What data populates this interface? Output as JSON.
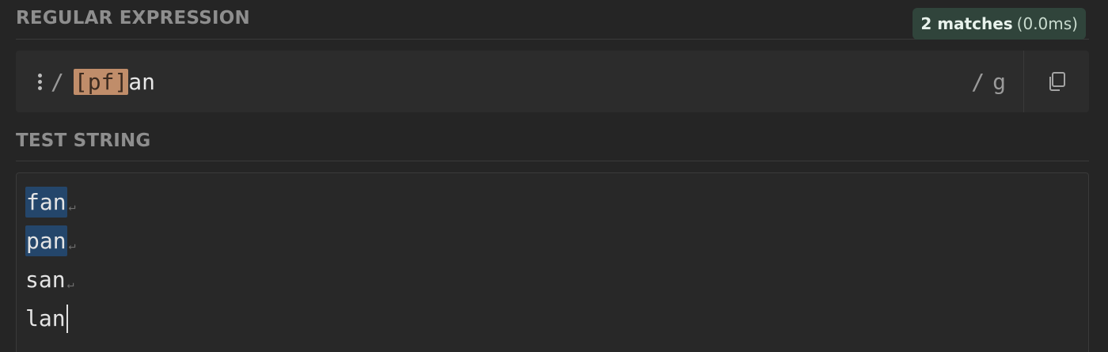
{
  "regex_section": {
    "title": "REGULAR EXPRESSION",
    "match_count": "2 matches",
    "match_time": "(0.0ms)",
    "open_delimiter": "/",
    "pattern_class": "[pf]",
    "pattern_rest": "an",
    "close_delimiter": "/",
    "flags": "g",
    "icons": {
      "menu": "vertical-dots-icon",
      "copy": "copy-icon"
    }
  },
  "test_section": {
    "title": "TEST STRING",
    "newline_symbol": "↵",
    "lines": [
      {
        "match": "fan",
        "rest": ""
      },
      {
        "match": "pan",
        "rest": ""
      },
      {
        "match": "",
        "rest": "san"
      },
      {
        "match": "",
        "rest": "lan"
      }
    ]
  },
  "colors": {
    "background": "#252525",
    "badge_bg": "#30443b",
    "char_class_highlight": "#c08d6a",
    "match_highlight": "#24466b"
  }
}
